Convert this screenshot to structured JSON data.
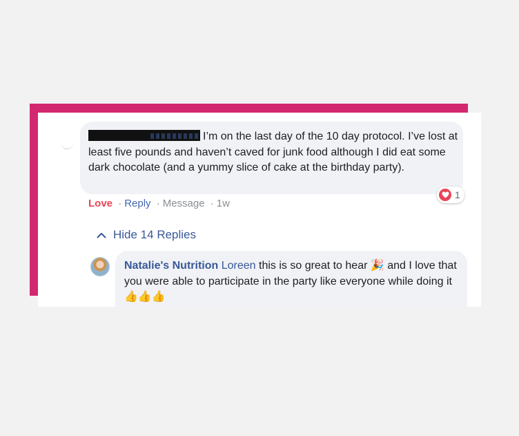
{
  "comment": {
    "text": "I’m on the last day of the 10 day protocol. I’ve lost at least five pounds and haven’t caved for junk food although I did eat some dark chocolate (and a yummy slice of cake at the birthday party).",
    "reaction_icon": "heart-icon",
    "reaction_count": "1",
    "actions": {
      "love": "Love",
      "reply": "Reply",
      "message": "Message",
      "time": "1w",
      "separator": "·"
    }
  },
  "replies_toggle": {
    "label": "Hide 14 Replies",
    "icon": "chevron-up-icon"
  },
  "reply": {
    "author": "Natalie's Nutrition",
    "mention": "Loreen",
    "text_part1": "this is so great to hear",
    "emoji1": "🎉",
    "text_part2": "and I love that you were able to participate in the party like everyone while doing it",
    "emoji2": "👍👍👍"
  },
  "colors": {
    "frame": "#d2286f",
    "bubble": "#f0f2f5",
    "link": "#385898",
    "love": "#e84557"
  }
}
